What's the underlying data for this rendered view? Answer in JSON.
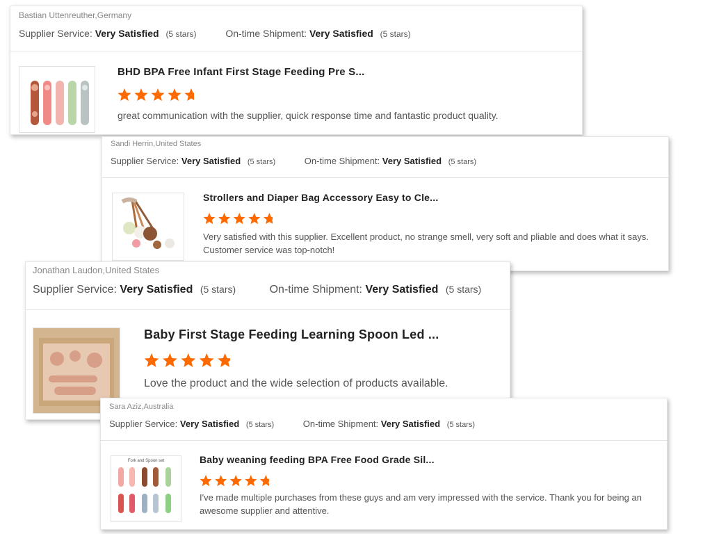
{
  "colors": {
    "star": "#ff6a00",
    "reviewer": "#888888",
    "text": "#555555"
  },
  "reviews": [
    {
      "reviewer": "Bastian Uttenreuther,Germany",
      "supplier_label": "Supplier Service:",
      "supplier_value": "Very Satisfied",
      "supplier_stars": "(5 stars)",
      "shipment_label": "On-time Shipment:",
      "shipment_value": "Very Satisfied",
      "shipment_stars": "(5 stars)",
      "product_title": "BHD BPA Free Infant First Stage Feeding Pre S...",
      "rating": 5,
      "comment": "great communication with the supplier, quick response time and fantastic product quality.",
      "thumbnail_icon": "spoons-thumbnail"
    },
    {
      "reviewer": "Sandi Herrin,United States",
      "supplier_label": "Supplier Service:",
      "supplier_value": "Very Satisfied",
      "supplier_stars": "(5 stars)",
      "shipment_label": "On-time Shipment:",
      "shipment_value": "Very Satisfied",
      "shipment_stars": "(5 stars)",
      "product_title": "Strollers and Diaper Bag Accessory Easy to Cle...",
      "rating": 5,
      "comment": "Very satisfied with this supplier.  Excellent product, no strange smell, very soft and pliable and does what it says.  Customer service was top-notch!",
      "thumbnail_icon": "pacifier-clips-thumbnail"
    },
    {
      "reviewer": "Jonathan Laudon,United States",
      "supplier_label": "Supplier Service:",
      "supplier_value": "Very Satisfied",
      "supplier_stars": "(5 stars)",
      "shipment_label": "On-time Shipment:",
      "shipment_value": "Very Satisfied",
      "shipment_stars": "(5 stars)",
      "product_title": "Baby First Stage Feeding Learning Spoon Led ...",
      "rating": 5,
      "comment": "Love the product and the wide selection of products available.",
      "thumbnail_icon": "gift-box-set-thumbnail"
    },
    {
      "reviewer": "Sara Aziz,Australia",
      "supplier_label": "Supplier Service:",
      "supplier_value": "Very Satisfied",
      "supplier_stars": "(5 stars)",
      "shipment_label": "On-time Shipment:",
      "shipment_value": "Very Satisfied",
      "shipment_stars": "(5 stars)",
      "product_title": "Baby weaning feeding BPA Free Food Grade Sil...",
      "rating": 5,
      "comment": "I've made multiple purchases from these guys and am very impressed with the service. Thank you for being an awesome supplier and attentive.",
      "thumbnail_caption": "Fork and Spoon set",
      "thumbnail_icon": "fork-spoon-set-thumbnail"
    }
  ]
}
